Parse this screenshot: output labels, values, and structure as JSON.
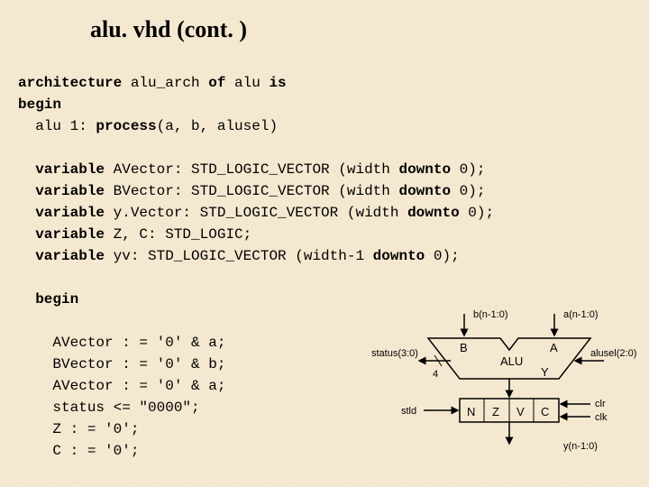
{
  "title": "alu. vhd  (cont. )",
  "code": {
    "l1a": "architecture",
    "l1b": " alu_arch ",
    "l1c": "of",
    "l1d": " alu ",
    "l1e": "is",
    "l2": "begin",
    "l3a": "  alu 1: ",
    "l3b": "process",
    "l3c": "(a, b, alusel)",
    "l4a": "  variable",
    "l4b": " AVector: STD_LOGIC_VECTOR (width ",
    "l4c": "downto",
    "l4d": " 0);",
    "l5a": "  variable",
    "l5b": " BVector: STD_LOGIC_VECTOR (width ",
    "l5c": "downto",
    "l5d": " 0);",
    "l6a": "  variable",
    "l6b": " y.Vector: STD_LOGIC_VECTOR (width ",
    "l6c": "downto",
    "l6d": " 0);",
    "l7a": "  variable",
    "l7b": " Z, C: STD_LOGIC;",
    "l8a": "  variable",
    "l8b": " yv: STD_LOGIC_VECTOR (width-1 ",
    "l8c": "downto",
    "l8d": " 0);",
    "l9": "  begin",
    "l10": "    AVector : = '0' & a;",
    "l11": "    BVector : = '0' & b;",
    "l12": "    AVector : = '0' & a;",
    "l13": "    status <= \"0000\";",
    "l14": "    Z : = '0';",
    "l15": "    C : = '0';"
  },
  "diagram": {
    "sig_b": "b(n-1:0)",
    "sig_a": "a(n-1:0)",
    "port_B": "B",
    "port_A": "A",
    "status": "status(3:0)",
    "alu": "ALU",
    "alusel": "alusel(2:0)",
    "four": "4",
    "port_Y": "Y",
    "stld": "stld",
    "N": "N",
    "Z": "Z",
    "V": "V",
    "C": "C",
    "clr": "clr",
    "clk": "clk",
    "y_out": "y(n-1:0)"
  }
}
